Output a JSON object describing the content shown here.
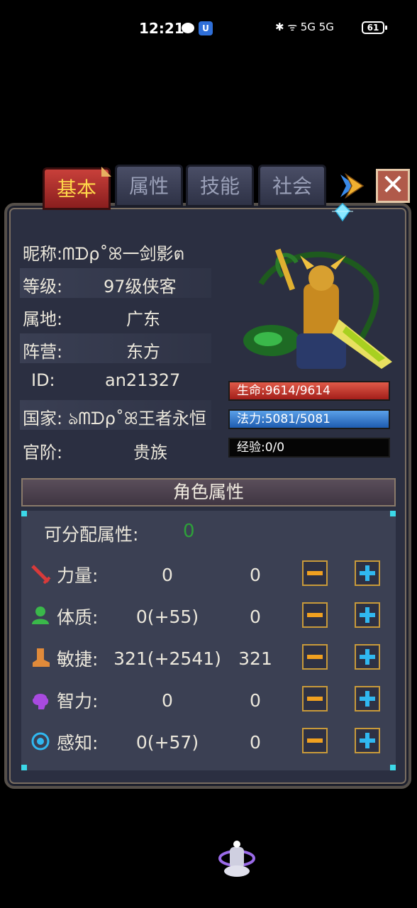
{
  "status_bar": {
    "time": "12:21",
    "shield_glyph": "U",
    "right_text": "✱ ᯤ 5G 5G",
    "battery": "61"
  },
  "tabs": [
    {
      "label": "基本",
      "active": true
    },
    {
      "label": "属性",
      "active": false
    },
    {
      "label": "技能",
      "active": false
    },
    {
      "label": "社会",
      "active": false
    }
  ],
  "close_label": "✕",
  "info": {
    "nickname_label": "昵称:",
    "nickname_value": "ᗰᗪρ˚ꕤ一剑影ต",
    "level_label": "等级:",
    "level_value": "97级侠客",
    "region_label": "属地:",
    "region_value": "广东",
    "camp_label": "阵营:",
    "camp_value": "东方",
    "id_label": "ID:",
    "id_value": "an21327",
    "country_label": "国家:",
    "country_value": "ঌᗰᗪρ˚ꕤ王者永恒",
    "rank_label": "官阶:",
    "rank_value": "贵族"
  },
  "bars": {
    "hp_text": "生命:9614/9614",
    "mp_text": "法力:5081/5081",
    "xp_text": "经验:0/0"
  },
  "section": {
    "title": "角色属性",
    "free_label": "可分配属性:",
    "free_value": "0"
  },
  "attributes": [
    {
      "label": "力量:",
      "value": "0",
      "base": "0",
      "icon": "sword-icon",
      "color": "#d83a3a"
    },
    {
      "label": "体质:",
      "value": "0(+55)",
      "base": "0",
      "icon": "person-icon",
      "color": "#3ab84a"
    },
    {
      "label": "敏捷:",
      "value": "321(+2541)",
      "base": "321",
      "icon": "boot-icon",
      "color": "#e08a3a"
    },
    {
      "label": "智力:",
      "value": "0",
      "base": "0",
      "icon": "brain-icon",
      "color": "#a84ae0"
    },
    {
      "label": "感知:",
      "value": "0(+57)",
      "base": "0",
      "icon": "eye-icon",
      "color": "#30b8f0"
    }
  ],
  "colors": {
    "panel_bg": "#2b2f41",
    "tab_active": "#c8403a",
    "tab_active_text": "#ffd84a",
    "hp_bar": "#c83a30",
    "mp_bar": "#3a7ed0",
    "free_value": "#2ea03a"
  }
}
